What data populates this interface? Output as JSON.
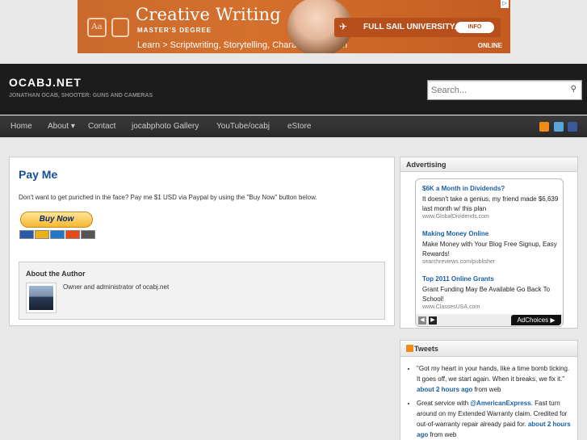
{
  "top_ad": {
    "title": "Creative Writing",
    "subtitle": "MASTER'S DEGREE",
    "line": "Learn > Scriptwriting, Storytelling, Character Creation",
    "school": "FULL SAIL UNIVERSITY.",
    "info": "INFO",
    "online": "ONLINE",
    "aa": "Aa",
    "colors": {
      "bg": "#d06a2c",
      "accent": "#b74f1d"
    }
  },
  "header": {
    "site_title": "OCABJ.NET",
    "tagline": "JONATHAN OCAB, SHOOTER: GUNS AND CAMERAS",
    "search_placeholder": "Search...",
    "search_icon": "search-icon"
  },
  "nav": {
    "items": [
      "Home",
      "About ▾",
      "Contact",
      "jocabphoto Gallery",
      "YouTube/ocabj",
      "eStore"
    ],
    "social": [
      {
        "icon": "rss-icon",
        "color": "#f28a18"
      },
      {
        "icon": "twitter-icon",
        "color": "#5aa6d9"
      },
      {
        "icon": "facebook-icon",
        "color": "#3b5998"
      }
    ]
  },
  "post": {
    "title": "Pay Me",
    "body": "Don't want to get punched in the face? Pay me $1 USD via Paypal by using the \"Buy Now\" button below.",
    "buy_label": "Buy Now",
    "cards": [
      "#2a5aa8",
      "#e8b11a",
      "#1f78c8",
      "#e64a19",
      "#555"
    ],
    "author_heading": "About the Author",
    "author_desc": "Owner and administrator of ocabj.net"
  },
  "sidebar": {
    "advertising_heading": "Advertising",
    "ads": [
      {
        "title": "$6K a Month in Dividends?",
        "desc": "It doesn't take a genius, my friend made $6,639 last month w/ this plan",
        "url": "www.GlobalDividends.com"
      },
      {
        "title": "Making Money Online",
        "desc": "Make Money with Your Blog Free Signup, Easy Rewards!",
        "url": "searchreviews.com/publisher"
      },
      {
        "title": "Top 2011 Online Grants",
        "desc": "Grant Funding May Be Available Go Back To School!",
        "url": "www.ClassesUSA.com"
      }
    ],
    "adchoices": "AdChoices ▶",
    "tweets_heading": "Tweets",
    "tweets": [
      {
        "text": "\"Got my heart in your hands, like a time bomb ticking. It goes off, we start again. When it breaks, we fix it.\" ",
        "link": "about 2 hours ago",
        "suffix": " from web"
      },
      {
        "text": "Great service with ",
        "mention": "@AmericanExpress",
        "text2": ". Fast turn around on my Extended Warranty claim. Credited for out-of-warranty repair already paid for. ",
        "link": "about 2 hours ago",
        "suffix": " from web"
      }
    ]
  }
}
